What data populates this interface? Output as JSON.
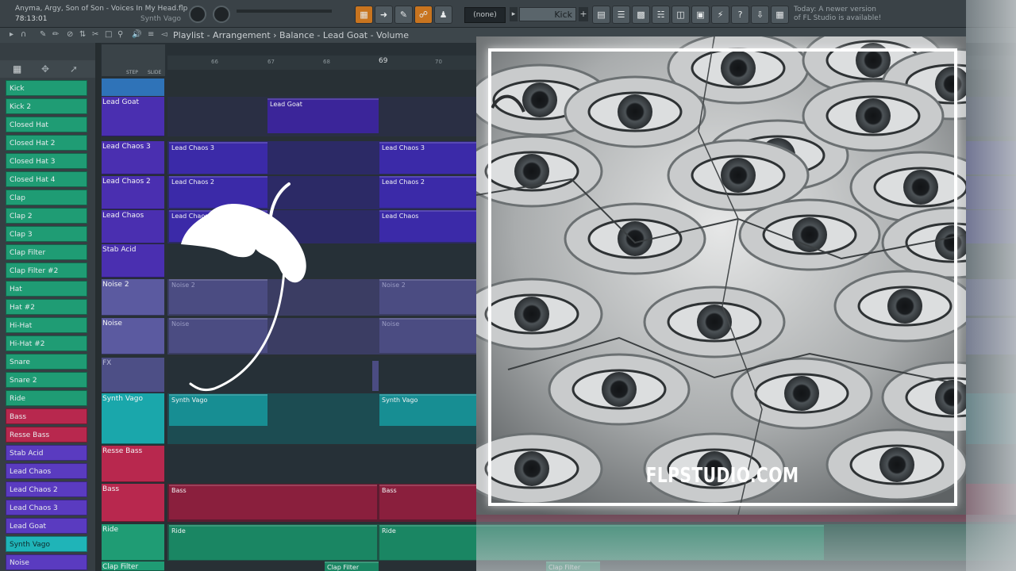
{
  "topbar": {
    "project_title": "Anyma, Argy, Son of Son - Voices In My Head.flp",
    "time": "78:13:01",
    "channel": "Synth Vago",
    "pattern_none": "(none)",
    "pattern_name": "Kick",
    "news_line1": "Today: A newer version",
    "news_line2": "of FL Studio is available!"
  },
  "playlist": {
    "breadcrumb": "Playlist - Arrangement › Balance - Lead Goat - Volume",
    "ruler": [
      "66",
      "67",
      "68",
      "69",
      "70"
    ],
    "step_label": "STEP",
    "slide_label": "SLIDE"
  },
  "channels": [
    {
      "label": "Kick",
      "color": "g"
    },
    {
      "label": "Kick 2",
      "color": "g"
    },
    {
      "label": "Closed Hat",
      "color": "g"
    },
    {
      "label": "Closed Hat 2",
      "color": "g"
    },
    {
      "label": "Closed Hat 3",
      "color": "g"
    },
    {
      "label": "Closed Hat 4",
      "color": "g"
    },
    {
      "label": "Clap",
      "color": "g"
    },
    {
      "label": "Clap 2",
      "color": "g"
    },
    {
      "label": "Clap 3",
      "color": "g"
    },
    {
      "label": "Clap Filter",
      "color": "g"
    },
    {
      "label": "Clap Filter #2",
      "color": "g"
    },
    {
      "label": "Hat",
      "color": "g"
    },
    {
      "label": "Hat #2",
      "color": "g"
    },
    {
      "label": "Hi-Hat",
      "color": "g"
    },
    {
      "label": "Hi-Hat #2",
      "color": "g"
    },
    {
      "label": "Snare",
      "color": "g"
    },
    {
      "label": "Snare 2",
      "color": "g"
    },
    {
      "label": "Ride",
      "color": "g"
    },
    {
      "label": "Bass",
      "color": "r"
    },
    {
      "label": "Resse Bass",
      "color": "r"
    },
    {
      "label": "Stab Acid",
      "color": "p"
    },
    {
      "label": "Lead Chaos",
      "color": "p"
    },
    {
      "label": "Lead Chaos 2",
      "color": "p"
    },
    {
      "label": "Lead Chaos 3",
      "color": "p"
    },
    {
      "label": "Lead Goat",
      "color": "p"
    },
    {
      "label": "Synth Vago",
      "color": "t"
    },
    {
      "label": "Noise",
      "color": "p"
    }
  ],
  "tracks": {
    "lead_goat": "Lead Goat",
    "lead_chaos_3": "Lead Chaos 3",
    "lead_chaos_2": "Lead Chaos 2",
    "lead_chaos": "Lead Chaos",
    "stab_acid": "Stab Acid",
    "noise_2": "Noise 2",
    "noise": "Noise",
    "fx": "FX",
    "synth_vago": "Synth Vago",
    "resse_bass": "Resse Bass",
    "bass": "Bass",
    "ride": "Ride",
    "clap_filter": "Clap Filter"
  },
  "overlay": {
    "brand": "FLPSTUDIO.COM"
  },
  "colors": {
    "green": "#1f9c74",
    "red": "#b8284e",
    "purple": "#5a3bc0",
    "teal": "#1fb4b8",
    "orange": "#c8741f"
  }
}
